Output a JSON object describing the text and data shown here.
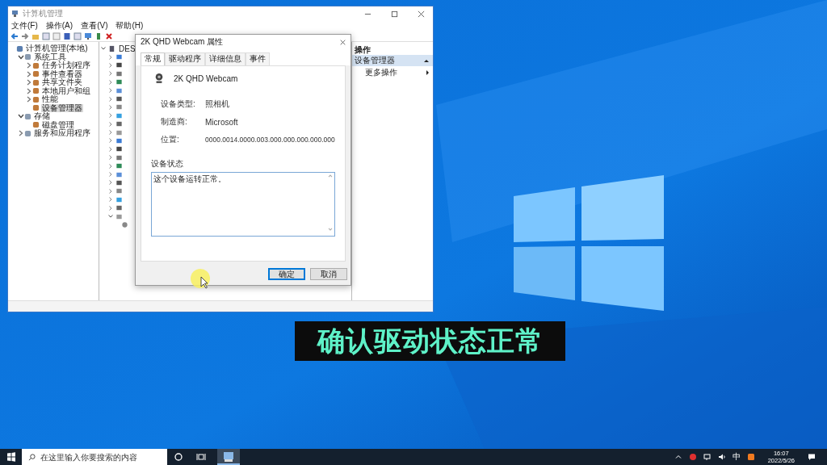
{
  "window": {
    "title": "计算机管理",
    "menu": [
      "文件(F)",
      "操作(A)",
      "查看(V)",
      "帮助(H)"
    ],
    "tree": [
      {
        "label": "计算机管理(本地)",
        "selected": false,
        "children": [
          {
            "label": "系统工具",
            "expanded": true,
            "selected": false,
            "children": [
              {
                "label": "任务计划程序",
                "expanded": false,
                "selected": false
              },
              {
                "label": "事件查看器",
                "expanded": false,
                "selected": false
              },
              {
                "label": "共享文件夹",
                "expanded": false,
                "selected": false
              },
              {
                "label": "本地用户和组",
                "expanded": false,
                "selected": false
              },
              {
                "label": "性能",
                "expanded": false,
                "selected": false
              },
              {
                "label": "设备管理器",
                "selected": true
              }
            ]
          },
          {
            "label": "存储",
            "expanded": true,
            "selected": false,
            "children": [
              {
                "label": "磁盘管理",
                "selected": false
              }
            ]
          },
          {
            "label": "服务和应用程序",
            "expanded": false,
            "selected": false
          }
        ]
      }
    ],
    "device_tree": {
      "root": "DES",
      "expanded": true,
      "rows": [
        {
          "expanded": false
        },
        {
          "expanded": false
        },
        {
          "expanded": false
        },
        {
          "expanded": false
        },
        {
          "expanded": false
        },
        {
          "expanded": false
        },
        {
          "expanded": false
        },
        {
          "expanded": false
        },
        {
          "expanded": false
        },
        {
          "expanded": false
        },
        {
          "expanded": false
        },
        {
          "expanded": false
        },
        {
          "expanded": false
        },
        {
          "expanded": false
        },
        {
          "expanded": false
        },
        {
          "expanded": false
        },
        {
          "expanded": false
        },
        {
          "expanded": false
        },
        {
          "expanded": false
        },
        {
          "expanded": true
        }
      ]
    },
    "actions": {
      "heading": "操作",
      "section": "设备管理器",
      "items": [
        "更多操作"
      ]
    }
  },
  "dialog": {
    "title": "2K QHD Webcam 属性",
    "tabs": [
      {
        "label": "常规",
        "selected": true
      },
      {
        "label": "驱动程序",
        "selected": false
      },
      {
        "label": "详细信息",
        "selected": false
      },
      {
        "label": "事件",
        "selected": false
      }
    ],
    "device_name": "2K QHD Webcam",
    "properties": [
      {
        "label": "设备类型:",
        "value": "照相机"
      },
      {
        "label": "制造商:",
        "value": "Microsoft"
      },
      {
        "label": "位置:",
        "value": "0000.0014.0000.003.000.000.000.000.000"
      }
    ],
    "status_label": "设备状态",
    "status_text": "这个设备运转正常。",
    "buttons": [
      {
        "label": "确定",
        "default": true
      },
      {
        "label": "取消",
        "default": false
      }
    ]
  },
  "caption": "确认驱动状态正常",
  "taskbar": {
    "search_placeholder": "在这里输入你要搜索的内容",
    "ime": "中",
    "time": "16:07",
    "date": "2022/5/26"
  }
}
